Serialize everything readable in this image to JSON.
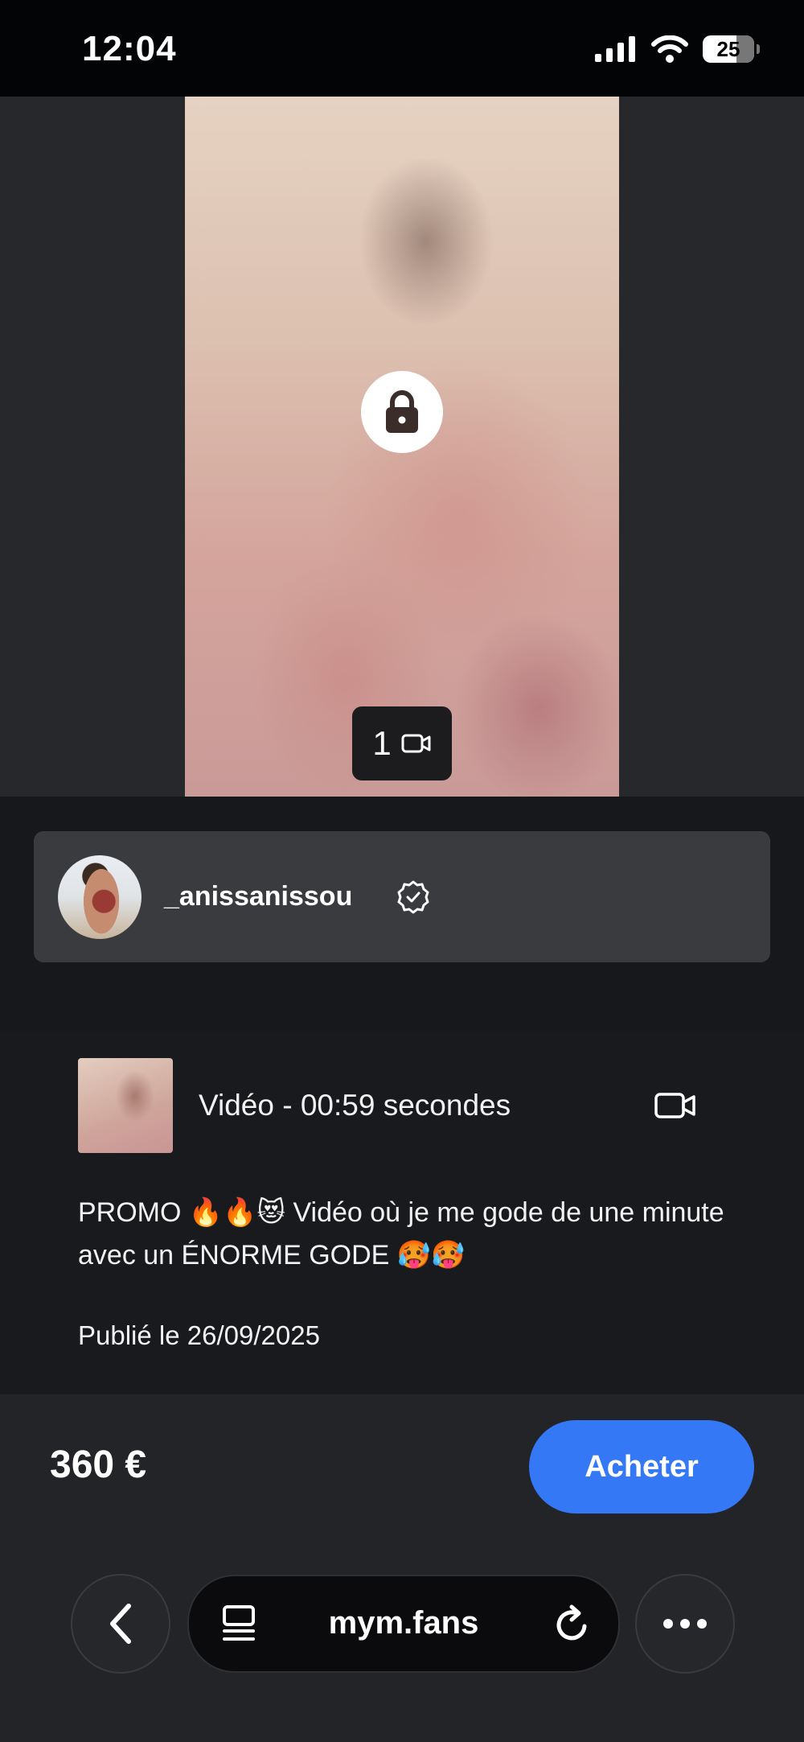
{
  "status_bar": {
    "time": "12:04",
    "battery": "25"
  },
  "media": {
    "count": "1",
    "lock_icon": "lock-icon",
    "type_icon": "video-camera-icon"
  },
  "creator": {
    "username": "_anissanissou",
    "verified_icon": "verified-badge-icon"
  },
  "post": {
    "video_meta": "Vidéo - 00:59 secondes",
    "description": "PROMO 🔥🔥😻 Vidéo où je me gode de une minute avec un ÉNORME GODE 🥵🥵",
    "published": "Publié le 26/09/2025"
  },
  "purchase": {
    "price": "360 €",
    "buy_label": "Acheter",
    "accent": "#3478f6"
  },
  "browser": {
    "url": "mym.fans",
    "icons": [
      "chevron-left-icon",
      "reader-icon",
      "reload-icon",
      "more-icon"
    ]
  }
}
